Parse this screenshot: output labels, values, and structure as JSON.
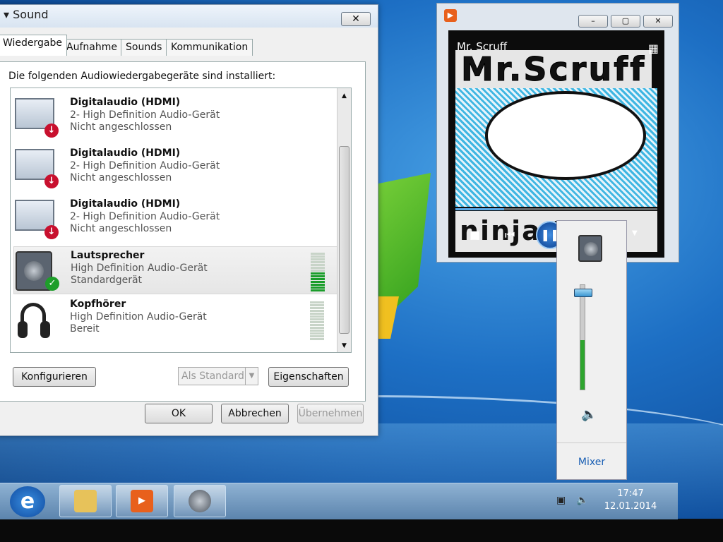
{
  "dialog": {
    "title": "Sound",
    "close_label": "✕",
    "tabs": [
      {
        "label": "Wiedergabe",
        "active": true
      },
      {
        "label": "Aufnahme",
        "active": false
      },
      {
        "label": "Sounds",
        "active": false
      },
      {
        "label": "Kommunikation",
        "active": false
      }
    ],
    "heading": "Die folgenden Audiowiedergabegeräte sind installiert:",
    "devices": [
      {
        "name": "Digitalaudio (HDMI)",
        "desc": "2- High Definition Audio-Gerät",
        "status": "Nicht angeschlossen",
        "icon": "monitor-icon",
        "badge": "disconnected"
      },
      {
        "name": "Digitalaudio (HDMI)",
        "desc": "2- High Definition Audio-Gerät",
        "status": "Nicht angeschlossen",
        "icon": "monitor-icon",
        "badge": "disconnected"
      },
      {
        "name": "Digitalaudio (HDMI)",
        "desc": "2- High Definition Audio-Gerät",
        "status": "Nicht angeschlossen",
        "icon": "monitor-icon",
        "badge": "disconnected"
      },
      {
        "name": "Lautsprecher",
        "desc": "High Definition Audio-Gerät",
        "status": "Standardgerät",
        "icon": "speaker-icon",
        "badge": "default",
        "selected": true,
        "level": 0.5
      },
      {
        "name": "Kopfhörer",
        "desc": "High Definition Audio-Gerät",
        "status": "Bereit",
        "icon": "headphones-icon",
        "badge": "none",
        "level": 0
      }
    ],
    "buttons": {
      "configure": "Konfigurieren",
      "set_default": "Als Standard",
      "properties": "Eigenschaften",
      "ok": "OK",
      "cancel": "Abbrechen",
      "apply": "Übernehmen"
    }
  },
  "player": {
    "artist": "Mr. Scruff",
    "art_title_text": "Mr.Scruff",
    "art_bottom_text": "ninja tuna",
    "controls": {
      "minimize": "–",
      "restore": "▢",
      "close": "✕"
    },
    "progress": 0.24,
    "play_state": "pause-icon"
  },
  "volume_popup": {
    "level": 0.47,
    "mixer_label": "Mixer",
    "mute_icon": "volume-icon"
  },
  "taskbar": {
    "time": "17:47",
    "date": "12.01.2014",
    "apps": [
      "internet-explorer-icon",
      "explorer-folder-icon",
      "media-player-icon",
      "sound-speaker-icon"
    ]
  }
}
